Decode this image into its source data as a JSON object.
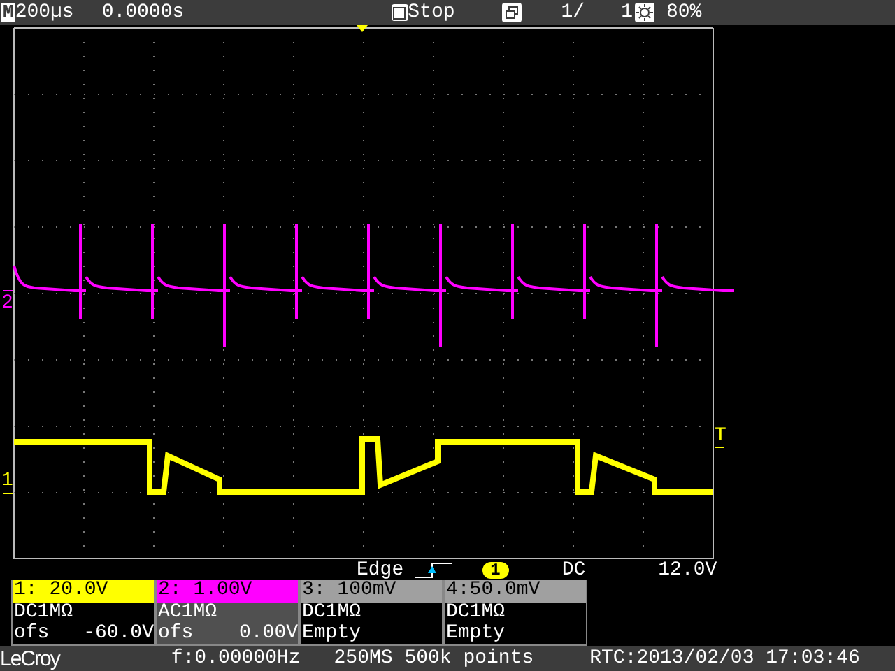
{
  "top_bar": {
    "mode_icon": "M",
    "timebase": "200µs",
    "delay": "0.0000s",
    "run_state": "Stop",
    "acquisitions": "1/",
    "acquisition_total": "1",
    "brightness": "80%"
  },
  "display": {
    "channel_markers": [
      {
        "label": "2",
        "color": "#ff00ff"
      },
      {
        "label": "1",
        "color": "#ffff00"
      }
    ],
    "trigger_marker": "T"
  },
  "trigger": {
    "type": "Edge",
    "source": "1",
    "coupling": "DC",
    "level": "12.0V"
  },
  "channels": [
    {
      "header": "1: 20.0V",
      "color": "#ffff00",
      "selected": false,
      "coupling": "DC1MΩ",
      "line_2": "ofs",
      "offset": "-60.0V"
    },
    {
      "header": "2: 1.00V",
      "color": "#ff00ff",
      "selected": true,
      "coupling": "AC1MΩ",
      "line_2": "ofs",
      "offset": "0.00V"
    },
    {
      "header": "3: 100mV",
      "color": "#a0a0a0",
      "selected": false,
      "coupling": "DC1MΩ",
      "line_2": "Empty"
    },
    {
      "header": "4:50.0mV",
      "color": "#a0a0a0",
      "selected": false,
      "coupling": "DC1MΩ",
      "line_2": "Empty"
    }
  ],
  "status_bar": {
    "brand": "LeCroy",
    "frequency": "f:0.00000Hz",
    "sample_info": "250MS 500k points",
    "clock": "RTC:2013/02/03 17:03:46"
  }
}
